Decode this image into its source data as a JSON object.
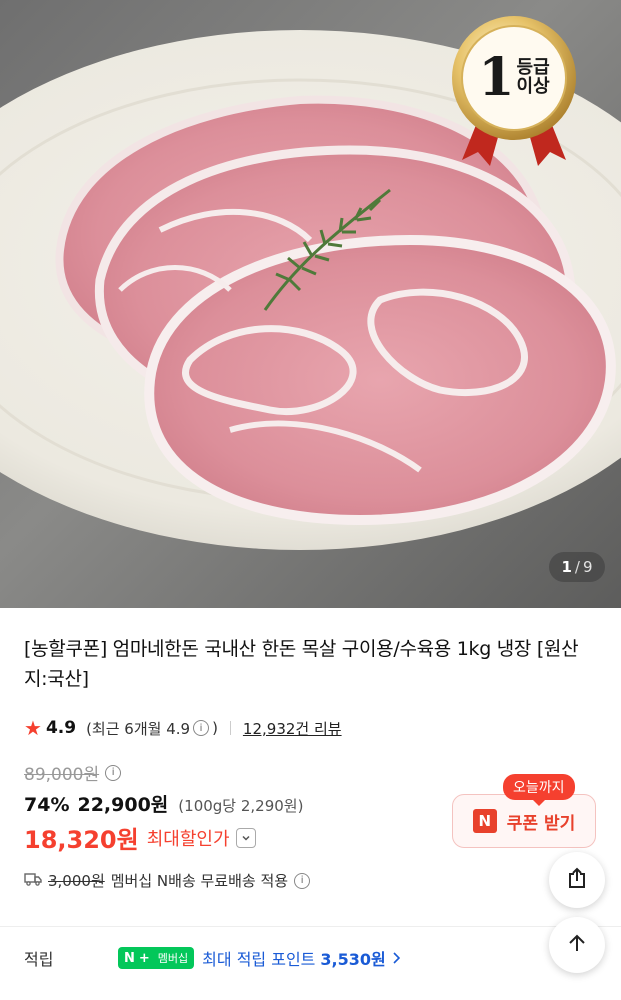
{
  "hero": {
    "badge_number": "1",
    "badge_line1": "등급",
    "badge_line2": "이상",
    "counter_current": "1",
    "counter_separator": "/",
    "counter_total": "9"
  },
  "product": {
    "title": "[농할쿠폰] 엄마네한돈 국내산 한돈 목살 구이용/수육용 1kg 냉장 [원산지:국산]",
    "rating": "4.9",
    "rating_recent": "(최근 6개월 4.9",
    "rating_recent_close": ")",
    "review_count": "12,932건 리뷰",
    "original_price": "89,000원",
    "discount_rate": "74%",
    "sale_price": "22,900원",
    "unit_price": "(100g당 2,290원)",
    "max_discount_price": "18,320원",
    "max_discount_label": "최대할인가"
  },
  "coupon": {
    "badge": "오늘까지",
    "n_letter": "N",
    "button_label": "쿠폰 받기"
  },
  "shipping": {
    "fee": "3,000원",
    "text": "멤버십 N배송 무료배송 적용"
  },
  "points": {
    "label": "적립",
    "badge_n": "N",
    "badge_plus": "+",
    "badge_text": "멤버십",
    "text": "최대 적립 포인트",
    "amount": "3,530원"
  },
  "icons": {
    "star": "star-icon",
    "info": "info-icon",
    "truck": "truck-icon",
    "share": "share-icon",
    "arrow_up": "arrow-up-icon",
    "chevron": "chevron-right-icon"
  },
  "colors": {
    "accent_red": "#f5402f",
    "naver_green": "#03c75a",
    "link_blue": "#1a5bd6"
  }
}
